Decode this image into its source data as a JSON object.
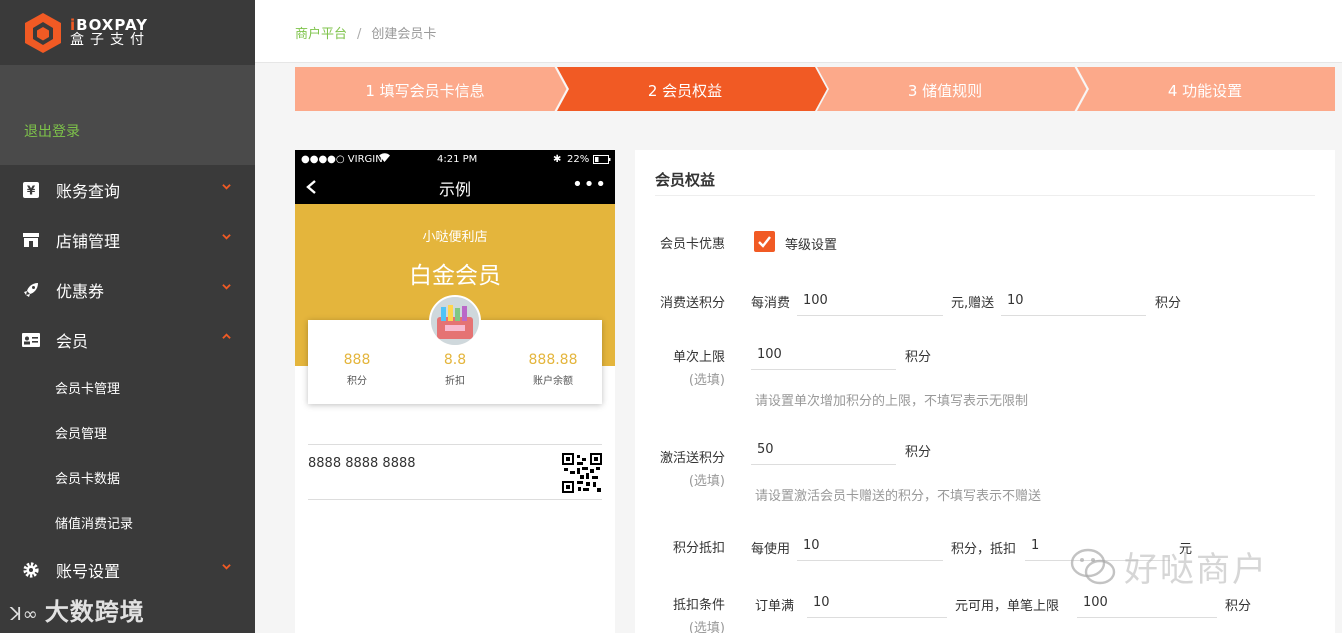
{
  "brand": {
    "logo_en_a": "i",
    "logo_en_b": "BOX",
    "logo_en_c": "PAY",
    "logo_cn": "盒子支付"
  },
  "sidebar": {
    "logout": "退出登录",
    "items": [
      {
        "label": "账务查询",
        "icon": "yen-icon"
      },
      {
        "label": "店铺管理",
        "icon": "store-icon"
      },
      {
        "label": "优惠券",
        "icon": "rocket-icon"
      },
      {
        "label": "会员",
        "icon": "member-card-icon"
      },
      {
        "label": "账号设置",
        "icon": "gear-icon"
      }
    ],
    "sub_items": [
      "会员卡管理",
      "会员管理",
      "会员卡数据",
      "储值消费记录"
    ]
  },
  "breadcrumb": {
    "root": "商户平台",
    "separator": "/",
    "current": "创建会员卡"
  },
  "steps": [
    {
      "label": "1 填写会员卡信息",
      "active": false
    },
    {
      "label": "2 会员权益",
      "active": true
    },
    {
      "label": "3 储值规则",
      "active": false
    },
    {
      "label": "4 功能设置",
      "active": false
    }
  ],
  "colors": {
    "accent": "#f15a24",
    "step_inactive": "#fca98a",
    "link_green": "#7ec34a",
    "card_gold": "#e4b53c",
    "sidebar": "#3a3a3a"
  },
  "phone": {
    "carrier": "●●●●○ VIRGIN",
    "time": "4:21 PM",
    "battery": "22%",
    "title": "示例",
    "more": "•••",
    "store_name": "小哒便利店",
    "level": "白金会员",
    "stats": [
      {
        "value": "888",
        "label": "积分"
      },
      {
        "value": "8.8",
        "label": "折扣"
      },
      {
        "value": "888.88",
        "label": "账户余额"
      }
    ],
    "card_number": "8888 8888 8888"
  },
  "form": {
    "title": "会员权益",
    "card_discount": {
      "label": "会员卡优惠",
      "checkbox_label": "等级设置",
      "checked": true
    },
    "consume_points": {
      "label": "消费送积分",
      "prefix": "每消费",
      "value1": "100",
      "mid": "元,赠送",
      "value2": "10",
      "suffix": "积分"
    },
    "single_limit": {
      "label": "单次上限",
      "optional": "(选填)",
      "value": "100",
      "suffix": "积分",
      "hint": "请设置单次增加积分的上限，不填写表示无限制"
    },
    "activate_points": {
      "label": "激活送积分",
      "optional": "(选填)",
      "value": "50",
      "suffix": "积分",
      "hint": "请设置激活会员卡赠送的积分，不填写表示不赠送"
    },
    "points_deduct": {
      "label": "积分抵扣",
      "prefix": "每使用",
      "value1": "10",
      "mid": "积分，抵扣",
      "value2": "1",
      "suffix": "元"
    },
    "deduct_condition": {
      "label": "抵扣条件",
      "optional": "(选填)",
      "prefix": "订单满",
      "value1": "10",
      "mid": "元可用，单笔上限",
      "value2": "100",
      "suffix": "积分"
    }
  },
  "watermarks": {
    "bottom_left": "大数跨境",
    "bottom_right": "好哒商户"
  }
}
